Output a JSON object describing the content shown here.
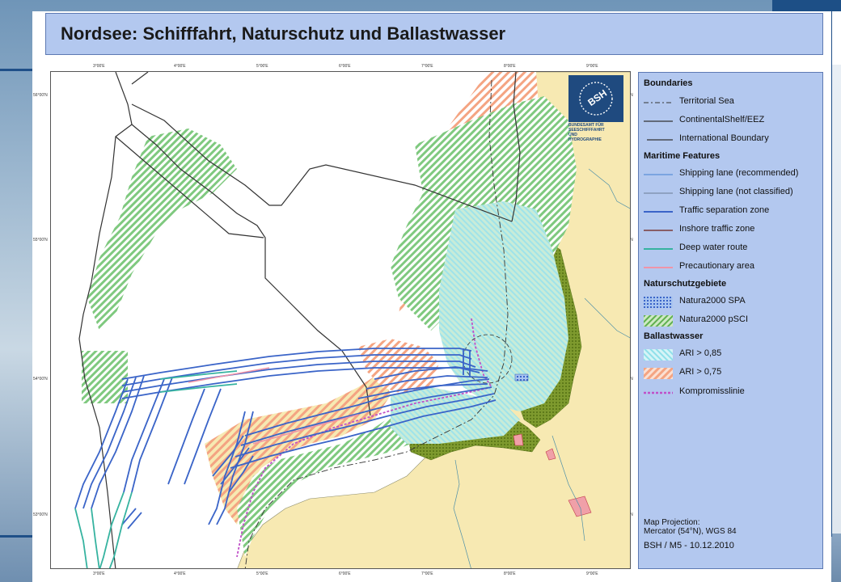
{
  "title": "Nordsee: Schifffahrt, Naturschutz und Ballastwasser",
  "logo": {
    "letters": "BSH",
    "name_lines": [
      "BUNDESAMT FÜR",
      "SEESCHIFFFAHRT",
      "UND",
      "HYDROGRAPHIE"
    ]
  },
  "ticks": {
    "top": [
      "3°00'E",
      "4°00'E",
      "5°00'E",
      "6°00'E",
      "7°00'E",
      "8°00'E",
      "9°00'E"
    ],
    "bottom": [
      "3°00'E",
      "4°00'E",
      "5°00'E",
      "6°00'E",
      "7°00'E",
      "8°00'E",
      "9°00'E"
    ],
    "left": [
      "56°00'N",
      "55°00'N",
      "54°00'N",
      "53°00'N"
    ],
    "right": [
      "56°00'N",
      "55°00'N",
      "54°00'N",
      "53°00'N"
    ]
  },
  "legend": {
    "boundaries": {
      "heading": "Boundaries",
      "items": [
        "Territorial Sea",
        "ContinentalShelf/EEZ",
        "International Boundary"
      ]
    },
    "maritime": {
      "heading": "Maritime Features",
      "items": [
        "Shipping lane (recommended)",
        "Shipping lane (not classified)",
        "Traffic separation zone",
        "Inshore traffic zone",
        "Deep water route",
        "Precautionary area"
      ]
    },
    "nature": {
      "heading": "Naturschutzgebiete",
      "items": [
        "Natura2000 SPA",
        "Natura2000 pSCI"
      ]
    },
    "ballast": {
      "heading": "Ballastwasser",
      "items": [
        "ARI > 0,85",
        "ARI > 0,75",
        "Kompromisslinie"
      ]
    },
    "projection_line1": "Map Projection:",
    "projection_line2": "Mercator (54°N), WGS 84",
    "credit": "BSH / M5 - 10.12.2010"
  },
  "colors": {
    "title_bg": "#b3c8ef",
    "land": "#f7e9b2",
    "tss": "#3a64c8",
    "deep_water": "#36b3a0",
    "precaution": "#ef94a8",
    "pSCI": "#7fc97f",
    "ari85": "#9fe3ea",
    "ari75": "#f4a482",
    "kompromiss": "#c050c8",
    "logo": "#1f4a7f"
  }
}
